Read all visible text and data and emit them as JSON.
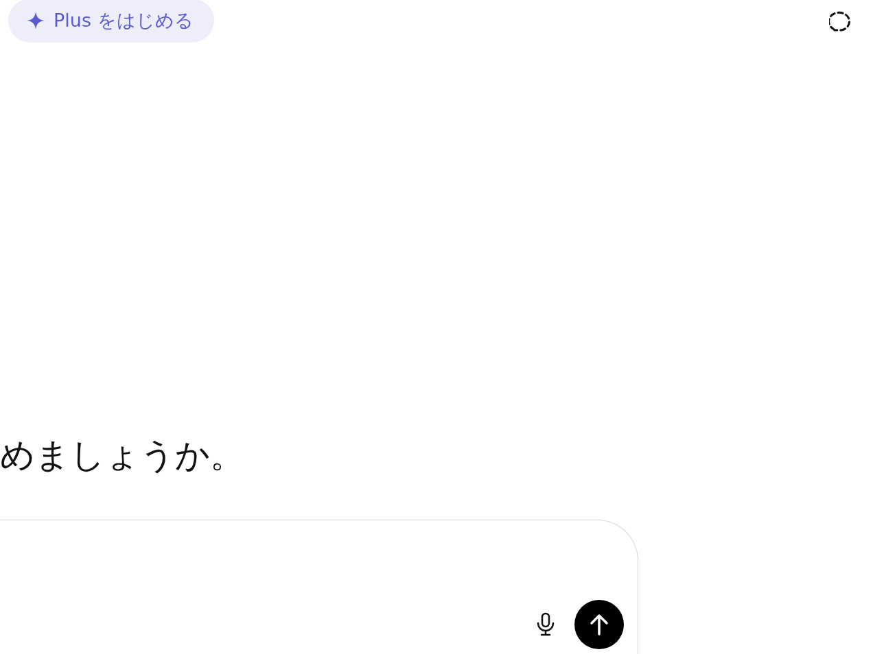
{
  "upgrade_button": {
    "label": "Plus をはじめる"
  },
  "heading": "めましょうか。"
}
